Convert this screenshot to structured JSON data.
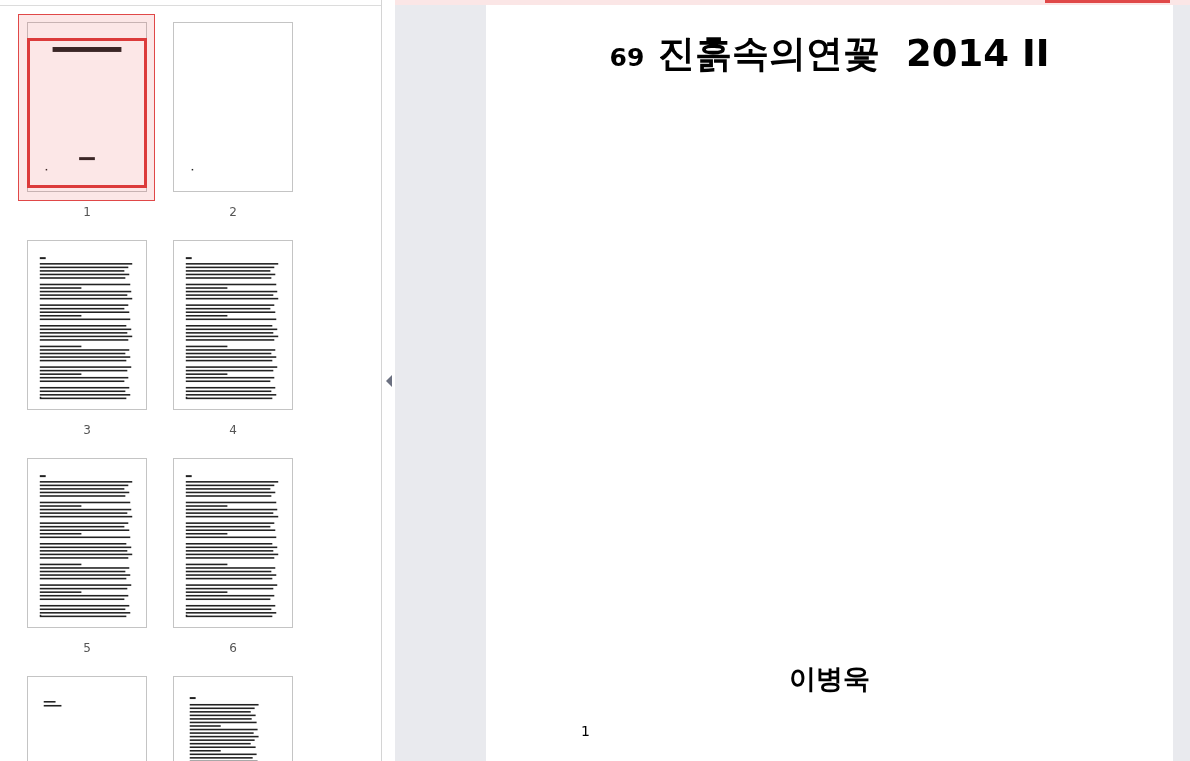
{
  "thumbnails": [
    {
      "label": "1",
      "selected": true,
      "kind": "title"
    },
    {
      "label": "2",
      "selected": false,
      "kind": "blank"
    },
    {
      "label": "3",
      "selected": false,
      "kind": "text"
    },
    {
      "label": "4",
      "selected": false,
      "kind": "text"
    },
    {
      "label": "5",
      "selected": false,
      "kind": "text"
    },
    {
      "label": "6",
      "selected": false,
      "kind": "text"
    },
    {
      "selected": false,
      "kind": "short"
    },
    {
      "selected": false,
      "kind": "toc"
    }
  ],
  "page": {
    "number_prefix": "69",
    "title": "진흙속의연꽃  2014 II",
    "author": "이병욱",
    "page_number": "1"
  }
}
